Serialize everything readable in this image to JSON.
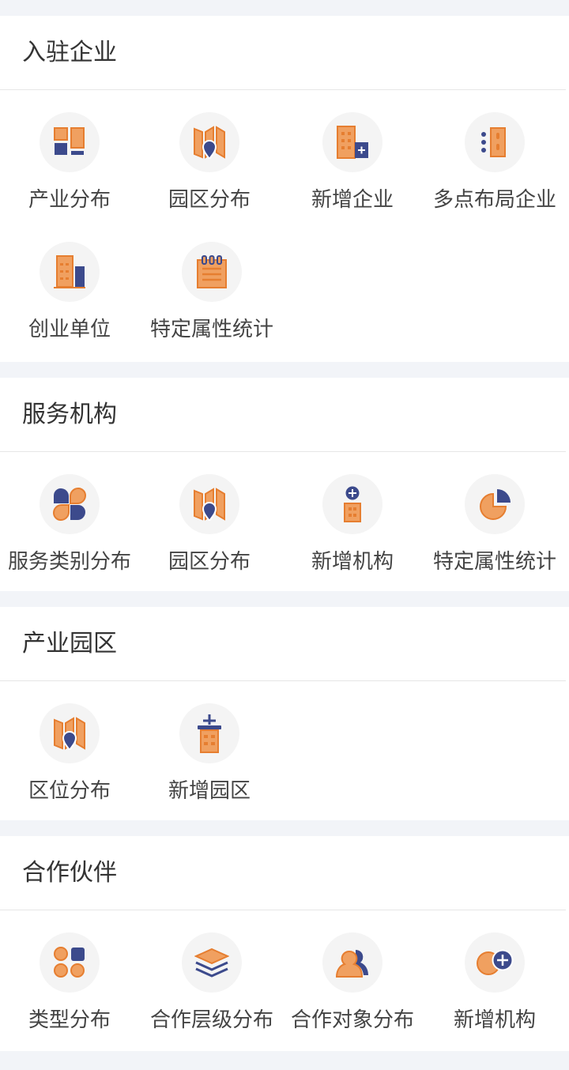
{
  "colors": {
    "orange": "#f0a060",
    "orange_stroke": "#e67e30",
    "navy": "#3c4a8c",
    "bg": "#f2f4f8"
  },
  "sections": [
    {
      "title": "入驻企业",
      "items": [
        {
          "label": "产业分布",
          "icon": "industry-distribution-icon"
        },
        {
          "label": "园区分布",
          "icon": "park-map-icon"
        },
        {
          "label": "新增企业",
          "icon": "add-company-icon"
        },
        {
          "label": "多点布局企业",
          "icon": "multi-point-icon"
        },
        {
          "label": "创业单位",
          "icon": "startup-building-icon"
        },
        {
          "label": "特定属性统计",
          "icon": "notepad-icon"
        }
      ]
    },
    {
      "title": "服务机构",
      "items": [
        {
          "label": "服务类别分布",
          "icon": "category-petals-icon"
        },
        {
          "label": "园区分布",
          "icon": "park-map-icon"
        },
        {
          "label": "新增机构",
          "icon": "add-org-icon"
        },
        {
          "label": "特定属性统计",
          "icon": "pie-chart-icon"
        }
      ]
    },
    {
      "title": "产业园区",
      "items": [
        {
          "label": "区位分布",
          "icon": "location-map-icon"
        },
        {
          "label": "新增园区",
          "icon": "add-park-icon"
        }
      ]
    },
    {
      "title": "合作伙伴",
      "items": [
        {
          "label": "类型分布",
          "icon": "type-grid-icon"
        },
        {
          "label": "合作层级分布",
          "icon": "layers-icon"
        },
        {
          "label": "合作对象分布",
          "icon": "partners-icon"
        },
        {
          "label": "新增机构",
          "icon": "add-partner-icon"
        }
      ]
    }
  ]
}
